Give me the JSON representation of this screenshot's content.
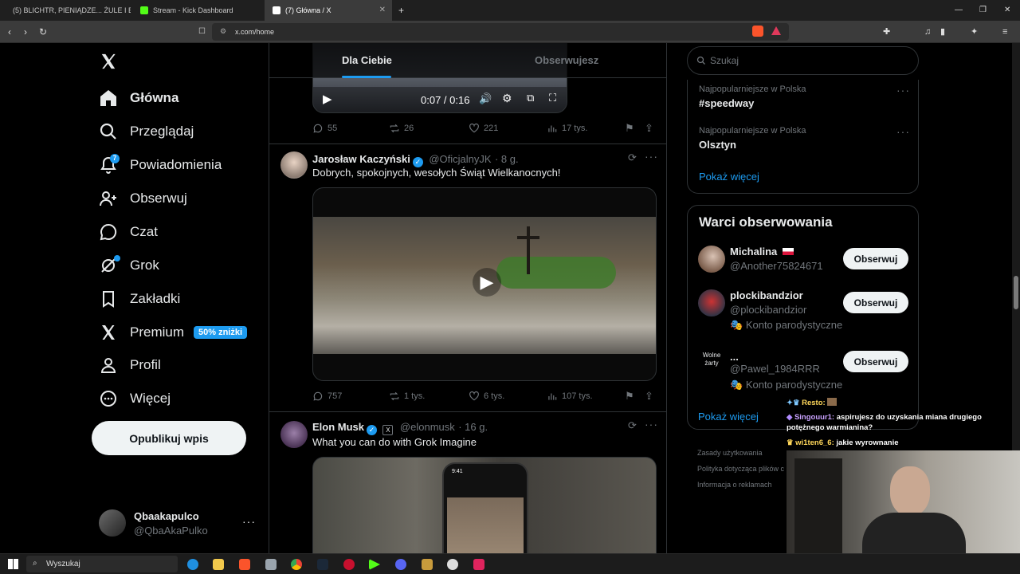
{
  "browser": {
    "tabs": [
      {
        "title": "(5) BLICHTR, PIENIĄDZE... ŻULE I BRU",
        "icon": "youtube-icon",
        "color": "#ff0033"
      },
      {
        "title": "Stream - Kick Dashboard",
        "icon": "kick-icon",
        "color": "#53fc18"
      },
      {
        "title": "(7) Główna / X",
        "icon": "x-icon",
        "color": "#ffffff"
      }
    ],
    "url": "x.com/home"
  },
  "sidebar": {
    "items": [
      {
        "label": "Główna",
        "icon": "home-icon"
      },
      {
        "label": "Przeglądaj",
        "icon": "search-icon"
      },
      {
        "label": "Powiadomienia",
        "icon": "bell-icon"
      },
      {
        "label": "Obserwuj",
        "icon": "follow-icon"
      },
      {
        "label": "Czat",
        "icon": "chat-icon"
      },
      {
        "label": "Grok",
        "icon": "grok-icon"
      },
      {
        "label": "Zakładki",
        "icon": "bookmark-icon"
      },
      {
        "label": "Premium",
        "icon": "x-premium-icon"
      },
      {
        "label": "Profil",
        "icon": "profile-icon"
      },
      {
        "label": "Więcej",
        "icon": "more-icon"
      }
    ],
    "notification_count": "7",
    "premium_badge": "50% zniżki",
    "post_button": "Opublikuj wpis",
    "account": {
      "name": "Qbaakapulco",
      "handle": "@QbaAkaPulko"
    }
  },
  "feed": {
    "tabs": [
      "Dla Ciebie",
      "Obserwujesz"
    ],
    "video_controls": {
      "time": "0:07 / 0:16"
    },
    "posts": [
      {
        "replies": "55",
        "reposts": "26",
        "likes": "221",
        "views": "17 tys."
      },
      {
        "name": "Jarosław Kaczyński",
        "handle": "@OficjalnyJK",
        "time": "· 8 g.",
        "text": "Dobrych, spokojnych, wesołych Świąt Wielkanocnych!",
        "replies": "757",
        "reposts": "1 tys.",
        "likes": "6 tys.",
        "views": "107 tys."
      },
      {
        "name": "Elon Musk",
        "handle": "@elonmusk",
        "time": "· 16 g.",
        "text": "What you can do with Grok Imagine",
        "phone_time": "9:41"
      }
    ]
  },
  "right": {
    "search_placeholder": "Szukaj",
    "trends": [
      {
        "context": "Najpopularniejsze w Polska",
        "name": "#speedway"
      },
      {
        "context": "Najpopularniejsze w Polska",
        "name": "Olsztyn"
      }
    ],
    "show_more": "Pokaż więcej",
    "who_to_follow_title": "Warci obserwowania",
    "suggestions": [
      {
        "name": "Michalina",
        "handle": "@Another75824671",
        "note": ""
      },
      {
        "name": "plockibandzior",
        "handle": "@plockibandzior",
        "note": "Konto parodystyczne"
      },
      {
        "name": "...",
        "handle": "@Pawel_1984RRR",
        "note": "Konto parodystyczne",
        "avatar_text": "Wolne żarty"
      }
    ],
    "follow_label": "Obserwuj",
    "footer": [
      "Zasady użytkowania",
      "Polityka dotycząca plików c",
      "Informacja o reklamach"
    ]
  },
  "chat_overlay": [
    {
      "user": "Resto:",
      "message": ""
    },
    {
      "user": "Singouur1:",
      "message": "aspirujesz do uzyskania miana drugiego potężnego warmianina?"
    },
    {
      "user": "wi1ten6_6:",
      "message": "jakie wyrownanie"
    }
  ],
  "taskbar": {
    "search": "Wyszukaj"
  }
}
